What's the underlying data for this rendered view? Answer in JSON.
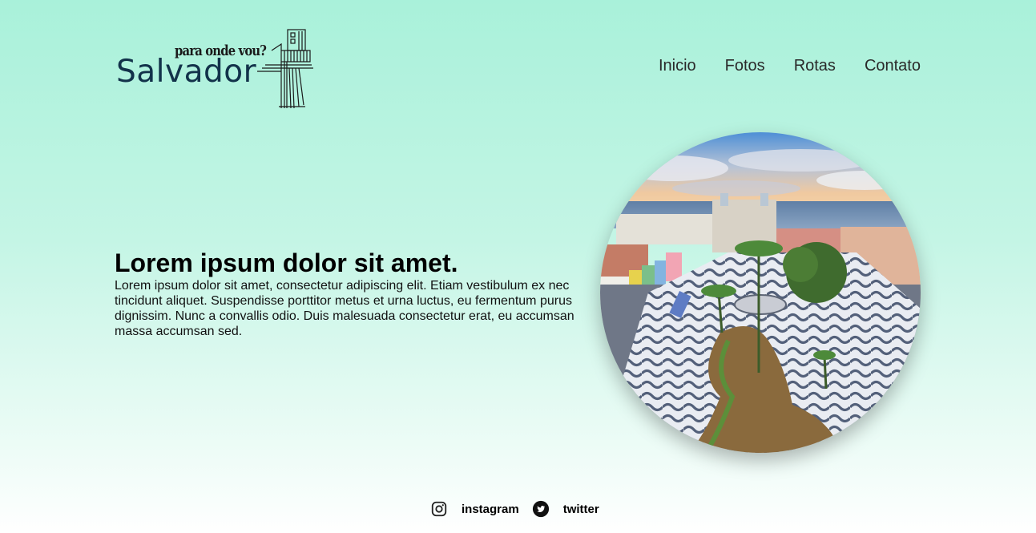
{
  "brand": {
    "tagline": "para onde vou?",
    "name": "Salvador"
  },
  "nav": {
    "items": [
      {
        "label": "Inicio"
      },
      {
        "label": "Fotos"
      },
      {
        "label": "Rotas"
      },
      {
        "label": "Contato"
      }
    ]
  },
  "hero": {
    "title": "Lorem ipsum dolor sit amet.",
    "body": "Lorem ipsum dolor sit amet, consectetur adipiscing elit. Etiam vestibulum ex nec tincidunt aliquet. Suspendisse porttitor metus et urna luctus, eu fermentum purus dignissim. Nunc a convallis odio. Duis malesuada consectetur erat, eu accumsan massa accumsan sed.",
    "image_icon": "photo-salvador-square"
  },
  "footer": {
    "social": [
      {
        "icon": "instagram-icon",
        "label": "instagram"
      },
      {
        "icon": "twitter-icon",
        "label": "twitter"
      }
    ]
  },
  "colors": {
    "background_top": "#a9f1da",
    "background_bottom": "#ffffff",
    "logo_text": "#12324a"
  }
}
